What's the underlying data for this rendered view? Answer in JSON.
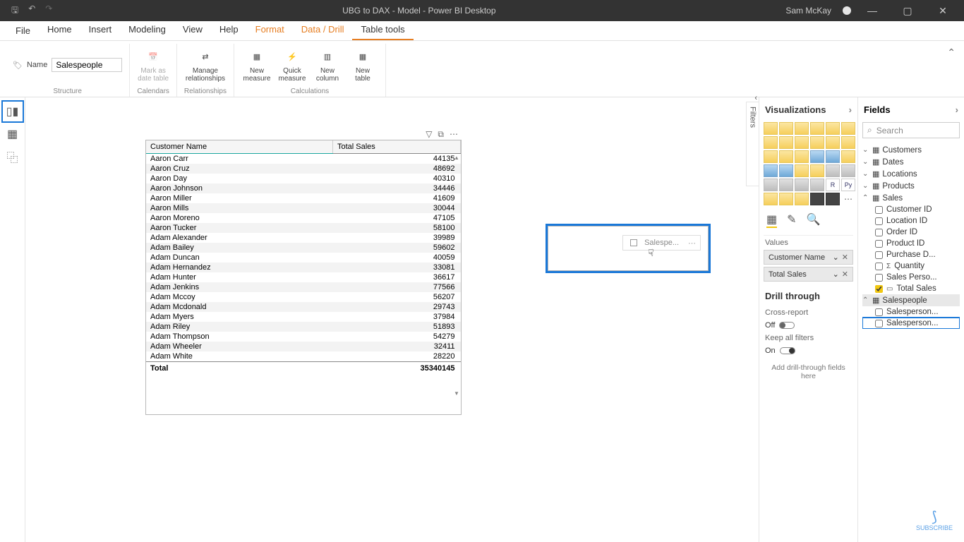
{
  "titlebar": {
    "title": "UBG to DAX - Model - Power BI Desktop",
    "user": "Sam McKay"
  },
  "menu": {
    "file": "File",
    "items": [
      "Home",
      "Insert",
      "Modeling",
      "View",
      "Help",
      "Format",
      "Data / Drill",
      "Table tools"
    ]
  },
  "ribbon": {
    "name_label": "Name",
    "name_value": "Salespeople",
    "mark_date": "Mark as date table",
    "manage_rel": "Manage relationships",
    "new_measure": "New measure",
    "quick_measure": "Quick measure",
    "new_column": "New column",
    "new_table": "New table",
    "groups": {
      "structure": "Structure",
      "calendars": "Calendars",
      "relationships": "Relationships",
      "calculations": "Calculations"
    }
  },
  "table": {
    "columns": [
      "Customer Name",
      "Total Sales"
    ],
    "rows": [
      {
        "name": "Aaron Carr",
        "val": "44135"
      },
      {
        "name": "Aaron Cruz",
        "val": "48692"
      },
      {
        "name": "Aaron Day",
        "val": "40310"
      },
      {
        "name": "Aaron Johnson",
        "val": "34446"
      },
      {
        "name": "Aaron Miller",
        "val": "41609"
      },
      {
        "name": "Aaron Mills",
        "val": "30044"
      },
      {
        "name": "Aaron Moreno",
        "val": "47105"
      },
      {
        "name": "Aaron Tucker",
        "val": "58100"
      },
      {
        "name": "Adam Alexander",
        "val": "39989"
      },
      {
        "name": "Adam Bailey",
        "val": "59602"
      },
      {
        "name": "Adam Duncan",
        "val": "40059"
      },
      {
        "name": "Adam Hernandez",
        "val": "33081"
      },
      {
        "name": "Adam Hunter",
        "val": "36617"
      },
      {
        "name": "Adam Jenkins",
        "val": "77566"
      },
      {
        "name": "Adam Mccoy",
        "val": "56207"
      },
      {
        "name": "Adam Mcdonald",
        "val": "29743"
      },
      {
        "name": "Adam Myers",
        "val": "37984"
      },
      {
        "name": "Adam Riley",
        "val": "51893"
      },
      {
        "name": "Adam Thompson",
        "val": "54279"
      },
      {
        "name": "Adam Wheeler",
        "val": "32411"
      },
      {
        "name": "Adam White",
        "val": "28220"
      }
    ],
    "total_label": "Total",
    "total_value": "35340145"
  },
  "drag_visual": {
    "label": "Salespe..."
  },
  "filters_tab": "Filters",
  "viz": {
    "header": "Visualizations",
    "values_label": "Values",
    "wells": [
      "Customer Name",
      "Total Sales"
    ],
    "drill_header": "Drill through",
    "cross_report": "Cross-report",
    "off": "Off",
    "keep_filters": "Keep all filters",
    "on": "On",
    "drill_drop": "Add drill-through fields here"
  },
  "fields": {
    "header": "Fields",
    "search_placeholder": "Search",
    "tables": {
      "customers": "Customers",
      "dates": "Dates",
      "locations": "Locations",
      "products": "Products",
      "sales": "Sales",
      "salespeople": "Salespeople"
    },
    "sales_fields": [
      "Customer ID",
      "Location ID",
      "Order ID",
      "Product ID",
      "Purchase D...",
      "Quantity",
      "Sales Perso...",
      "Total Sales"
    ],
    "salespeople_fields": [
      "Salesperson...",
      "Salesperson..."
    ]
  },
  "logo": "SUBSCRIBE"
}
